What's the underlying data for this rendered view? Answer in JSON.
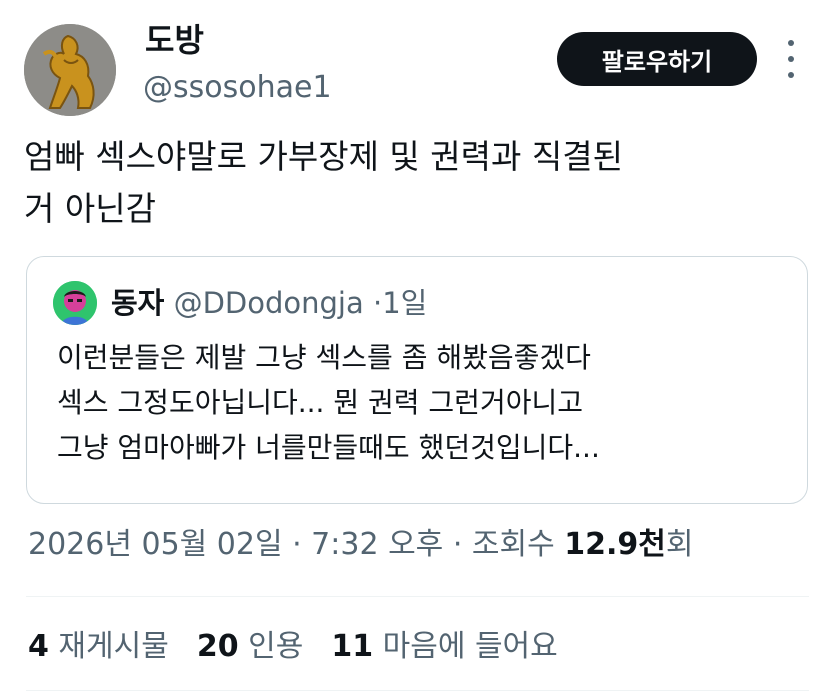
{
  "author": {
    "display_name": "도방",
    "handle": "@ssosohae1"
  },
  "follow_button_label": "팔로우하기",
  "tweet_text": "엄빠 섹스야말로 가부장제 및 권력과 직결된\n거 아닌감",
  "quoted_tweet": {
    "display_name": "동자",
    "handle": "@DDodongja",
    "separator": "·",
    "time": "1일",
    "text": "이런분들은 제발 그냥 섹스를 좀 해봤음좋겠다\n섹스 그정도아닙니다... 뭔 권력 그런거아니고\n그냥 엄마아빠가 너를만들때도 했던것입니다..."
  },
  "meta": {
    "datetime": "2026년 05월 02일 · 7:32 오후 · 조회수 ",
    "views_count": "12.9천",
    "views_suffix": "회"
  },
  "stats": {
    "retweets_count": "4",
    "retweets_label": "재게시물",
    "quotes_count": "20",
    "quotes_label": "인용",
    "likes_count": "11",
    "likes_label": "마음에 들어요"
  }
}
